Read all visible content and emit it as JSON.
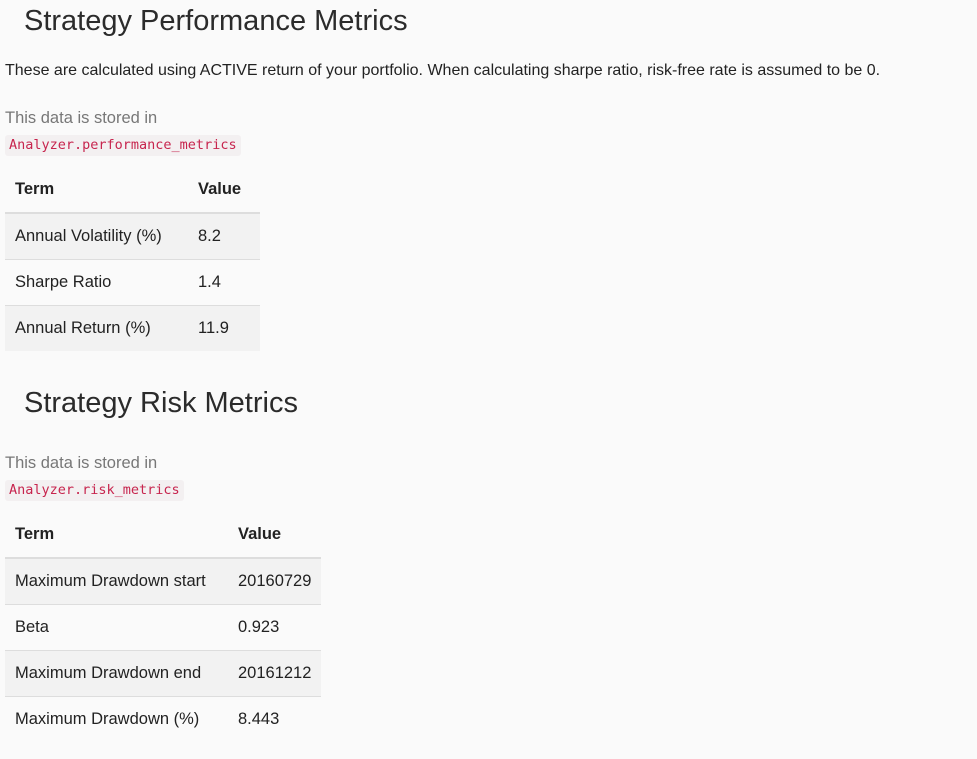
{
  "performance": {
    "title": "Strategy Performance Metrics",
    "intro": "These are calculated using ACTIVE return of your portfolio. When calculating sharpe ratio, risk-free rate is assumed to be 0.",
    "stored_text": "This data is stored in",
    "stored_code": "Analyzer.performance_metrics",
    "headers": {
      "term": "Term",
      "value": "Value"
    },
    "rows": [
      {
        "term": "Annual Volatility (%)",
        "value": "8.2"
      },
      {
        "term": "Sharpe Ratio",
        "value": "1.4"
      },
      {
        "term": "Annual Return (%)",
        "value": "11.9"
      }
    ]
  },
  "risk": {
    "title": "Strategy Risk Metrics",
    "stored_text": "This data is stored in",
    "stored_code": "Analyzer.risk_metrics",
    "headers": {
      "term": "Term",
      "value": "Value"
    },
    "rows": [
      {
        "term": "Maximum Drawdown start",
        "value": "20160729"
      },
      {
        "term": "Beta",
        "value": "0.923"
      },
      {
        "term": "Maximum Drawdown end",
        "value": "20161212"
      },
      {
        "term": "Maximum Drawdown (%)",
        "value": "8.443"
      }
    ]
  }
}
